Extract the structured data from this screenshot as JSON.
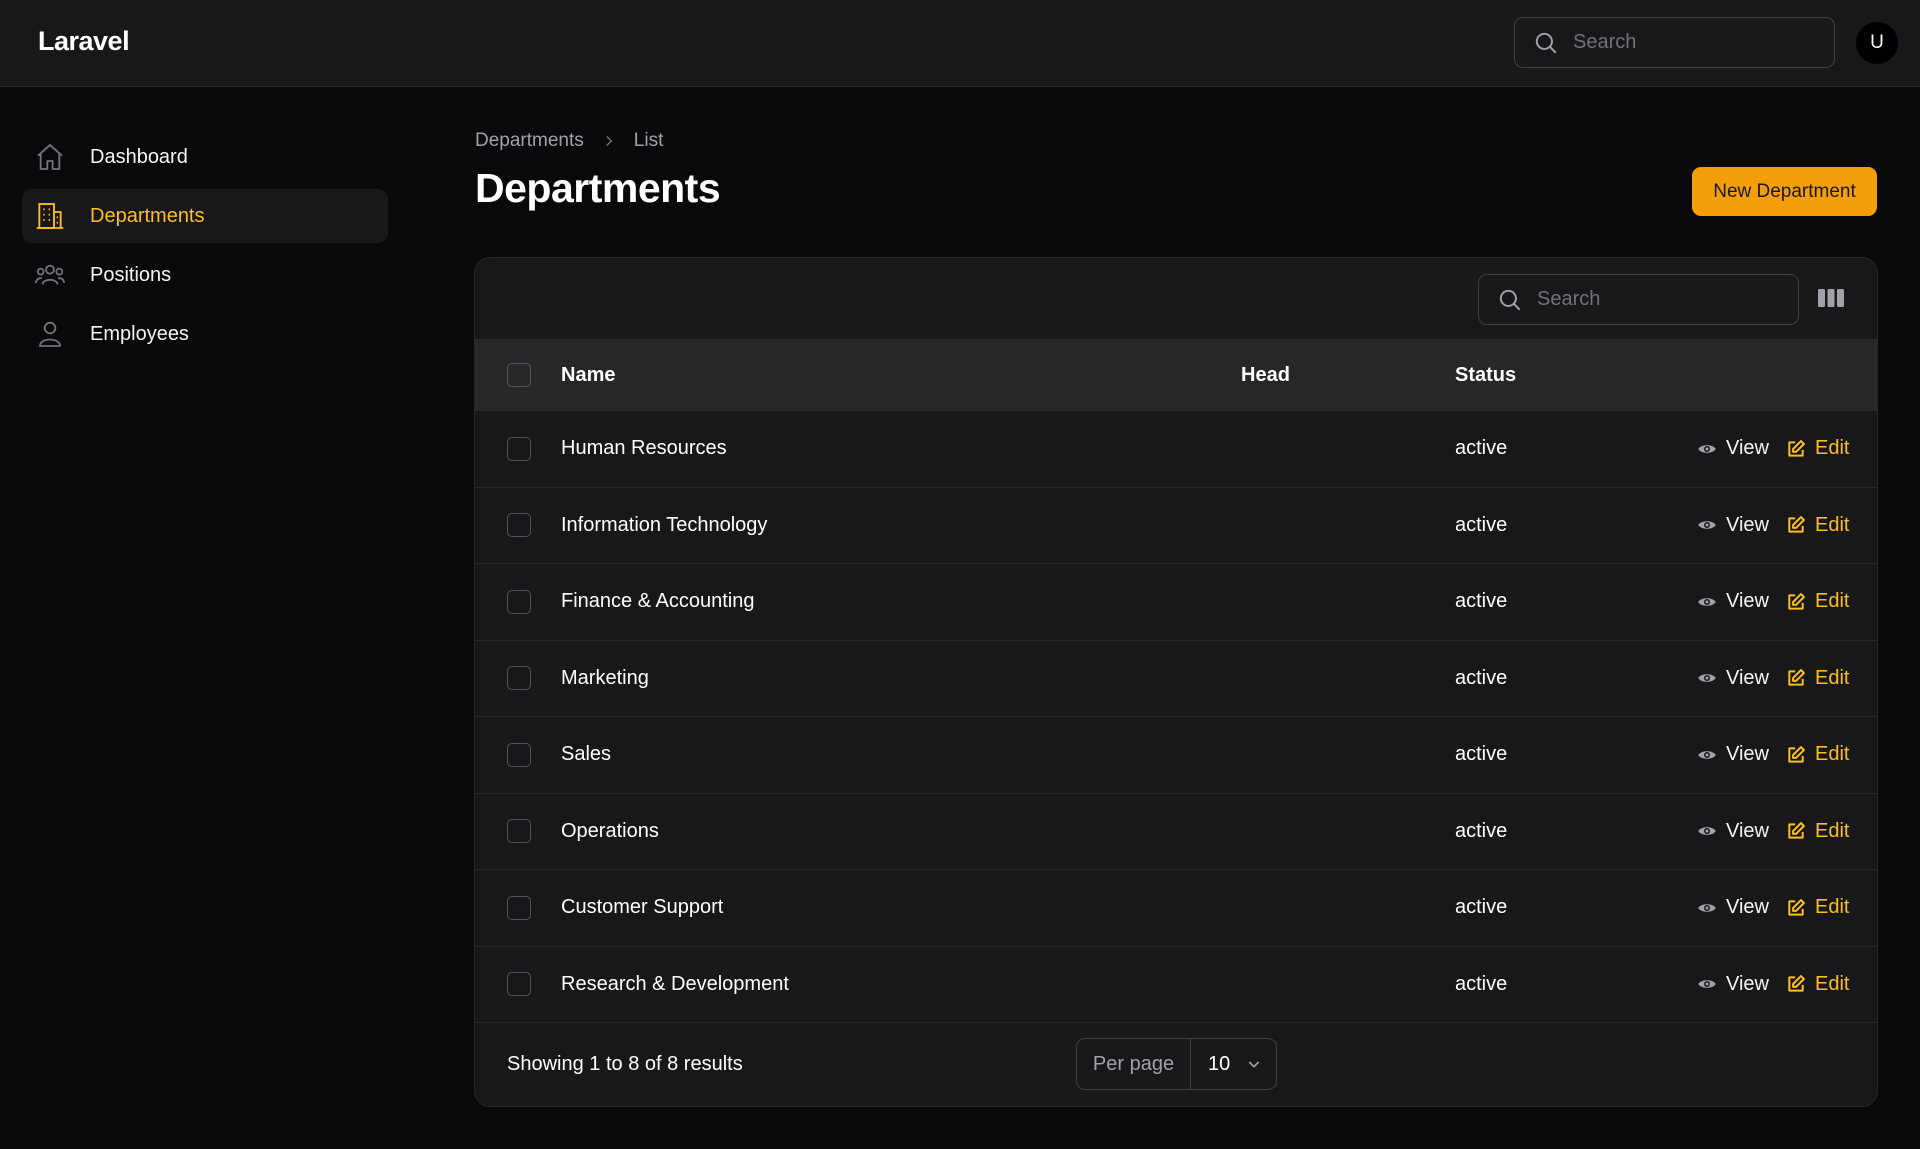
{
  "app": {
    "brand": "Laravel",
    "accent": "#f59e0b"
  },
  "topbar": {
    "search_placeholder": "Search",
    "avatar_initial": "U"
  },
  "sidebar": {
    "items": [
      {
        "label": "Dashboard",
        "icon": "home-icon",
        "active": false
      },
      {
        "label": "Departments",
        "icon": "building-icon",
        "active": true
      },
      {
        "label": "Positions",
        "icon": "user-group-icon",
        "active": false
      },
      {
        "label": "Employees",
        "icon": "user-icon",
        "active": false
      }
    ]
  },
  "page": {
    "breadcrumb": [
      "Departments",
      "List"
    ],
    "title": "Departments",
    "new_button": "New Department"
  },
  "table": {
    "search_placeholder": "Search",
    "columns": [
      "Name",
      "Head",
      "Status"
    ],
    "rows": [
      {
        "name": "Human Resources",
        "head": "",
        "status": "active"
      },
      {
        "name": "Information Technology",
        "head": "",
        "status": "active"
      },
      {
        "name": "Finance & Accounting",
        "head": "",
        "status": "active"
      },
      {
        "name": "Marketing",
        "head": "",
        "status": "active"
      },
      {
        "name": "Sales",
        "head": "",
        "status": "active"
      },
      {
        "name": "Operations",
        "head": "",
        "status": "active"
      },
      {
        "name": "Customer Support",
        "head": "",
        "status": "active"
      },
      {
        "name": "Research & Development",
        "head": "",
        "status": "active"
      }
    ],
    "actions": {
      "view": "View",
      "edit": "Edit"
    },
    "footer": {
      "results": "Showing 1 to 8 of 8 results",
      "per_page_label": "Per page",
      "per_page_value": "10"
    }
  }
}
